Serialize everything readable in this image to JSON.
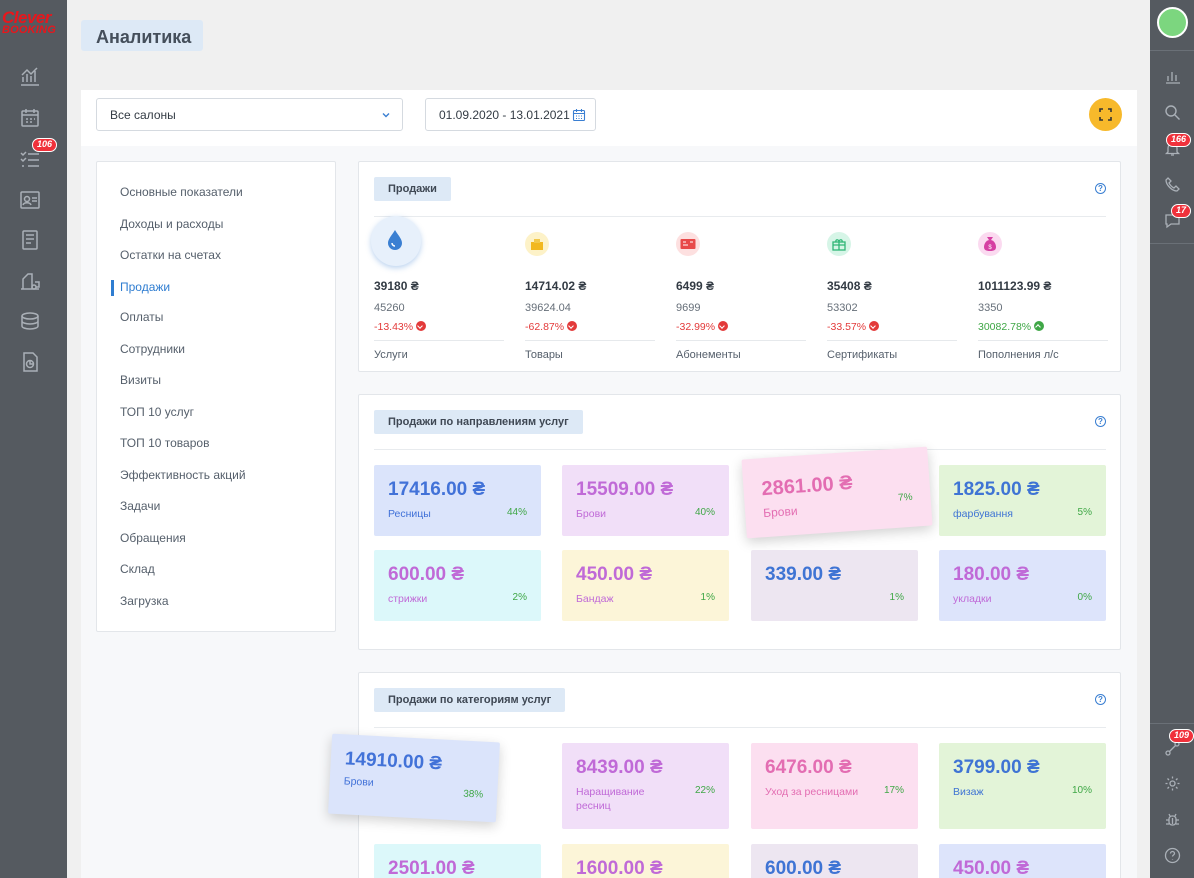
{
  "brand": {
    "logo_line1": "Clever",
    "logo_line2": "BOOKING"
  },
  "left_nav": {
    "items": [
      {
        "icon": "analytics-icon"
      },
      {
        "icon": "calendar-icon"
      },
      {
        "icon": "tasks-icon",
        "badge": "106"
      },
      {
        "icon": "clients-icon"
      },
      {
        "icon": "journal-icon"
      },
      {
        "icon": "warehouse-icon"
      },
      {
        "icon": "finance-icon"
      },
      {
        "icon": "reports-icon"
      }
    ]
  },
  "right_nav": {
    "badges": {
      "notifications": "166",
      "messages": "17",
      "integrations": "109"
    }
  },
  "page": {
    "title": "Аналитика"
  },
  "filters": {
    "salon_select": "Все салоны",
    "date_range": "01.09.2020 - 13.01.2021"
  },
  "menu": {
    "items": [
      "Основные показатели",
      "Доходы и расходы",
      "Остатки на счетах",
      "Продажи",
      "Оплаты",
      "Сотрудники",
      "Визиты",
      "ТОП 10 услуг",
      "ТОП 10 товаров",
      "Эффективность акций",
      "Задачи",
      "Обращения",
      "Склад",
      "Загрузка"
    ],
    "active": "Продажи"
  },
  "sales": {
    "title": "Продажи",
    "help": "?",
    "stats": [
      {
        "value": "39180 ₴",
        "prev": "45260",
        "delta": "-13.43%",
        "trend": "down",
        "name": "Услуги",
        "color": "#3a7fd2",
        "icon": "drop-icon"
      },
      {
        "value": "14714.02 ₴",
        "prev": "39624.04",
        "delta": "-62.87%",
        "trend": "down",
        "name": "Товары",
        "color": "#f2c230",
        "icon": "products-icon"
      },
      {
        "value": "6499 ₴",
        "prev": "9699",
        "delta": "-32.99%",
        "trend": "down",
        "name": "Абонементы",
        "color": "#e84a4a",
        "icon": "subscription-icon"
      },
      {
        "value": "35408 ₴",
        "prev": "53302",
        "delta": "-33.57%",
        "trend": "down",
        "name": "Сертификаты",
        "color": "#3ec485",
        "icon": "gift-icon"
      },
      {
        "value": "1011123.99 ₴",
        "prev": "3350",
        "delta": "30082.78%",
        "trend": "up",
        "name": "Пополнения л/с",
        "color": "#e04fb0",
        "icon": "money-bag-icon"
      }
    ],
    "colors": {
      "down": "#e33a3a",
      "up": "#3fa746"
    }
  },
  "directions": {
    "title": "Продажи по направлениям услуг",
    "help": "?",
    "tiles": [
      {
        "amount": "17416.00 ₴",
        "label": "Ресницы",
        "pct": "44%"
      },
      {
        "amount": "15509.00 ₴",
        "label": "Брови",
        "pct": "40%"
      },
      {
        "amount": "2861.00 ₴",
        "label": "Брови",
        "pct": "7%"
      },
      {
        "amount": "1825.00 ₴",
        "label": "фарбування",
        "pct": "5%"
      },
      {
        "amount": "600.00 ₴",
        "label": "стрижки",
        "pct": "2%"
      },
      {
        "amount": "450.00 ₴",
        "label": "Бандаж",
        "pct": "1%"
      },
      {
        "amount": "339.00 ₴",
        "label": "",
        "pct": "1%"
      },
      {
        "amount": "180.00 ₴",
        "label": "укладки",
        "pct": "0%"
      }
    ]
  },
  "categories": {
    "title": "Продажи по категориям услуг",
    "help": "?",
    "tiles": [
      {
        "amount": "14910.00 ₴",
        "label": "Брови",
        "pct": "38%"
      },
      {
        "amount": "8439.00 ₴",
        "label": "Наращивание ресниц",
        "pct": "22%"
      },
      {
        "amount": "6476.00 ₴",
        "label": "Уход за ресницами",
        "pct": "17%"
      },
      {
        "amount": "3799.00 ₴",
        "label": "Визаж",
        "pct": "10%"
      },
      {
        "amount": "2501.00 ₴",
        "label": "",
        "pct": ""
      },
      {
        "amount": "1600.00 ₴",
        "label": "",
        "pct": ""
      },
      {
        "amount": "600.00 ₴",
        "label": "",
        "pct": ""
      },
      {
        "amount": "450.00 ₴",
        "label": "",
        "pct": ""
      }
    ]
  }
}
